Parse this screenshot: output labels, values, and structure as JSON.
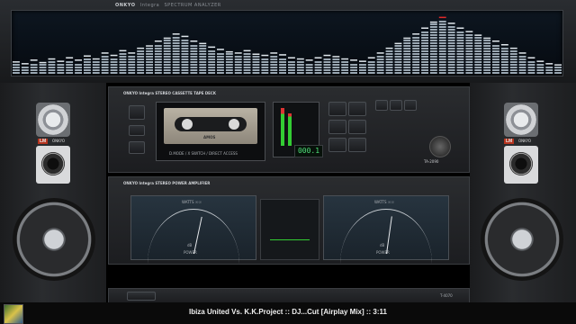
{
  "analyzer": {
    "brand": "ONKYO",
    "model": "Integra",
    "subtitle": "SPECTRUM ANALYZER",
    "levels": [
      0.15,
      0.12,
      0.18,
      0.14,
      0.2,
      0.16,
      0.22,
      0.18,
      0.25,
      0.2,
      0.3,
      0.26,
      0.34,
      0.3,
      0.38,
      0.42,
      0.5,
      0.55,
      0.62,
      0.58,
      0.5,
      0.46,
      0.4,
      0.36,
      0.32,
      0.3,
      0.34,
      0.28,
      0.26,
      0.3,
      0.27,
      0.22,
      0.2,
      0.18,
      0.22,
      0.26,
      0.24,
      0.2,
      0.18,
      0.16,
      0.22,
      0.3,
      0.38,
      0.46,
      0.55,
      0.62,
      0.72,
      0.82,
      0.9,
      0.8,
      0.72,
      0.66,
      0.6,
      0.55,
      0.5,
      0.44,
      0.38,
      0.3,
      0.22,
      0.16,
      0.12,
      0.1
    ],
    "accent": "#9aa7b2",
    "peak_color": "#e02a2a"
  },
  "deck": {
    "brand": "ONKYO",
    "model": "Integra",
    "subtitle": "STEREO CASSETTE TAPE DECK",
    "counter": "000.1",
    "model_no": "TA-2090",
    "tape_label": "AMOS",
    "tape_caption": "D.MODE / X SWITCH / DIRECT ACCESS"
  },
  "amp": {
    "brand": "ONKYO",
    "model": "Integra",
    "subtitle": "STEREO POWER AMPLIFIER",
    "left_meter": {
      "title": "WATTS ☉☉",
      "label": "POWER",
      "unit": "dB"
    },
    "right_meter": {
      "title": "WATTS ☉☉",
      "label": "POWER",
      "unit": "dB"
    },
    "scale": [
      "-20",
      "-10",
      "0",
      "0.2",
      "1",
      "2",
      "5",
      "10",
      "20",
      "50",
      "100",
      "200",
      "500"
    ],
    "left_level": 0.62,
    "right_level": 0.58
  },
  "speakers": {
    "left_brand": "ONKYO",
    "right_brand": "ONKYO",
    "badge": "LM"
  },
  "tuner": {
    "model_no": "T-4070"
  },
  "status": {
    "now_playing": "Ibiza United Vs. K.K.Project :: DJ...Cut [Airplay Mix] :: 3:11"
  }
}
